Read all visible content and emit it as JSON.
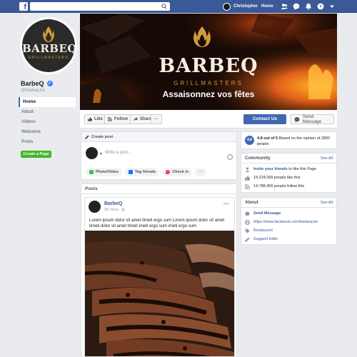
{
  "topbar": {
    "brand_icon": "f",
    "search_icon": "search-icon",
    "user_name": "Christopher",
    "home_label": "Home"
  },
  "profile": {
    "logo_name": "BARBEQ",
    "logo_sub": "GRILLMASTERS",
    "page_name": "BarbeQ",
    "handle": "@Barbeq.be"
  },
  "sidebar": {
    "items": [
      {
        "label": "Home"
      },
      {
        "label": "About"
      },
      {
        "label": "Videos"
      },
      {
        "label": "Welcome"
      },
      {
        "label": "Posts"
      }
    ],
    "create_page": "Create a Page"
  },
  "cover": {
    "brand": "BARBEQ",
    "sub": "GRILLMASTERS",
    "tagline": "Assaisonnez vos fêtes"
  },
  "actions": {
    "like": "Like",
    "follow": "Follow",
    "share": "Share",
    "more": "···",
    "contact": "Contact Us",
    "message": "Send Message"
  },
  "create_post": {
    "header": "Create post",
    "placeholder": "Write a post...",
    "buttons": [
      {
        "label": "Photo/Video",
        "color": "#45bd62"
      },
      {
        "label": "Tag friends",
        "color": "#1877f2"
      },
      {
        "label": "Check in",
        "color": "#f3425f"
      },
      {
        "label": "···"
      }
    ]
  },
  "posts": {
    "title": "Posts",
    "author": "BarbeQ",
    "time": "30 mins",
    "more": "···",
    "text": "Lorem ipsum dolor sit amet timeti ergo sum Lorem ipsum dolor sit amet timeti dolor sit amet timeti imeti ergo sum imeti ergo sum"
  },
  "rating": {
    "badge": "4.8",
    "score": "4.8 out of 5",
    "basis": "Based on the opinion of 2800 people"
  },
  "community": {
    "title": "Community",
    "see_all": "See All",
    "invite_link": "Invite your friends",
    "invite_rest": "to like this Page",
    "likes": "14,224,065 people like this",
    "follows": "14,788,456 people follow this"
  },
  "about": {
    "title": "About",
    "see_all": "See All",
    "send_message": "Send Message",
    "url": "https://www.facebook.com/barbeq.be",
    "category": "Restaurant",
    "suggest": "Suggest Edits"
  },
  "colors": {
    "facebook_blue": "#3b5998",
    "button_blue": "#4267b2",
    "green": "#42b72a",
    "brand_gold": "#d19a3a"
  }
}
